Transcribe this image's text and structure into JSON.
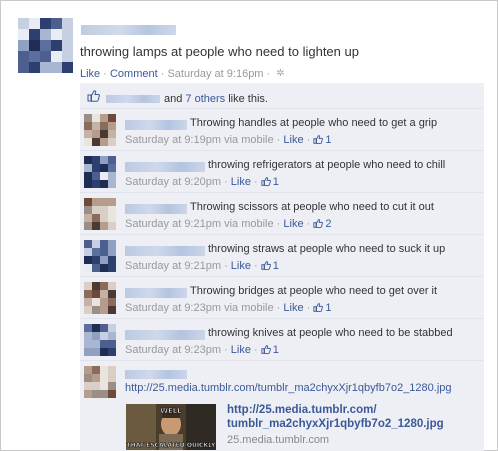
{
  "post": {
    "text": "throwing lamps at people who need to lighten up",
    "like_label": "Like",
    "comment_label": "Comment",
    "timestamp": "Saturday at 9:16pm",
    "separator": "·"
  },
  "likes": {
    "text_and": "and",
    "others_link": "7 others",
    "text_suffix": "like this."
  },
  "comments": [
    {
      "text": "Throwing handles at people who need to get a grip",
      "time": "Saturday at 9:19pm",
      "via": "via mobile",
      "like_label": "Like",
      "like_count": "1"
    },
    {
      "text": "throwing refrigerators at people who need to chill",
      "time": "Saturday at 9:20pm",
      "via": "",
      "like_label": "Like",
      "like_count": "1"
    },
    {
      "text": "Throwing scissors at people who need to cut it out",
      "time": "Saturday at 9:21pm",
      "via": "via mobile",
      "like_label": "Like",
      "like_count": "2"
    },
    {
      "text": "throwing straws at people who need to suck it up",
      "time": "Saturday at 9:21pm",
      "via": "",
      "like_label": "Like",
      "like_count": "1"
    },
    {
      "text": "Throwing bridges at people who need to get over it",
      "time": "Saturday at 9:23pm",
      "via": "via mobile",
      "like_label": "Like",
      "like_count": "1"
    },
    {
      "text": "throwing knives at people who need to be stabbed",
      "time": "Saturday at 9:23pm",
      "via": "",
      "like_label": "Like",
      "like_count": "1"
    }
  ],
  "link_comment": {
    "url": "http://25.media.tumblr.com/tumblr_ma2chyxXjr1qbyfb7o2_1280.jpg",
    "preview_title_line1": "http://25.media.tumblr.com/",
    "preview_title_line2": "tumblr_ma2chyxXjr1qbyfb7o2_1280.jpg",
    "preview_domain": "25.media.tumblr.com",
    "image_top_text": "WELL",
    "image_bottom_text": "THAT ESCALATED QUICKLY"
  },
  "colors": {
    "link": "#3b5998",
    "meta": "#999999",
    "comment_bg": "#edeff4"
  }
}
